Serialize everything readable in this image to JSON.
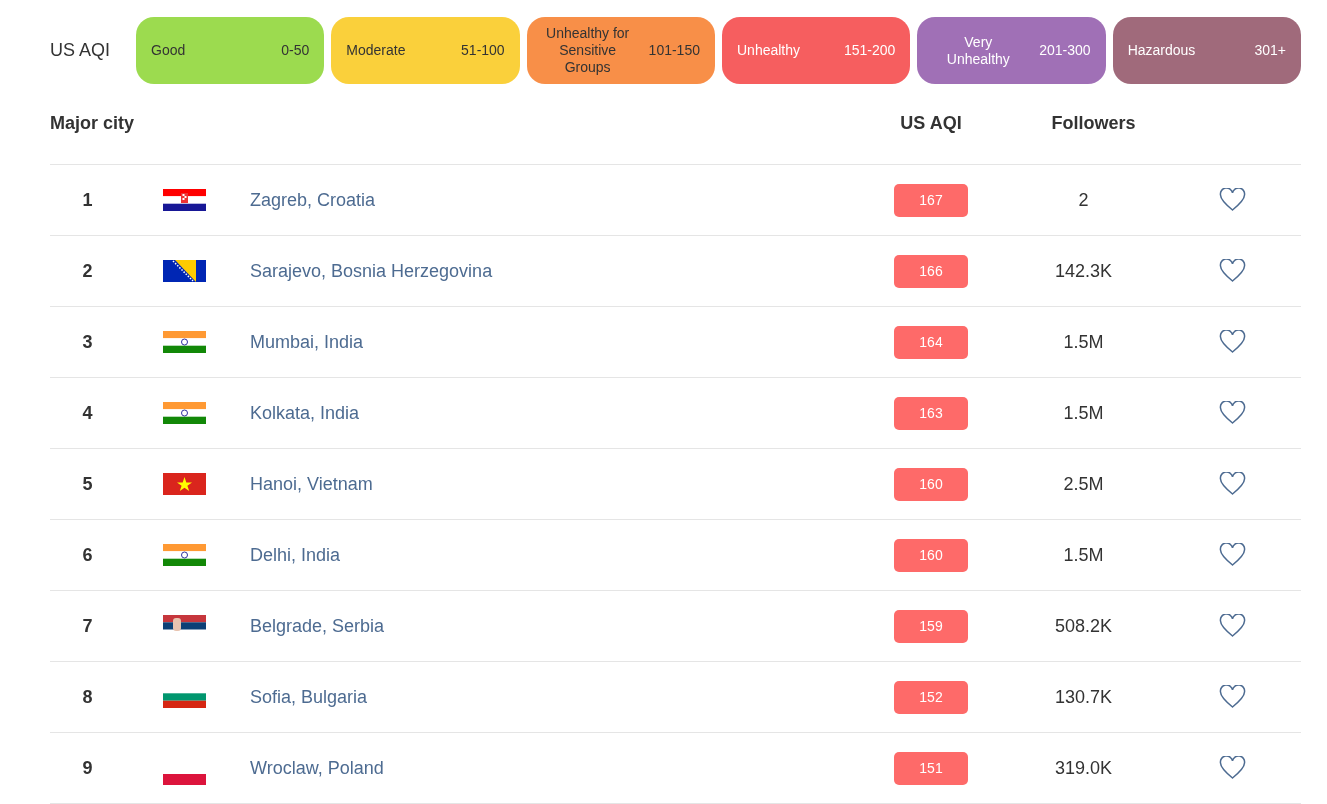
{
  "legend": {
    "label": "US AQI",
    "levels": [
      {
        "name": "Good",
        "range": "0-50",
        "color": "#9cdb4f"
      },
      {
        "name": "Moderate",
        "range": "51-100",
        "color": "#fad03b"
      },
      {
        "name": "Unhealthy for Sensitive Groups",
        "range": "101-150",
        "color": "#f88f48"
      },
      {
        "name": "Unhealthy",
        "range": "151-200",
        "color": "#f65e5f"
      },
      {
        "name": "Very Unhealthy",
        "range": "201-300",
        "color": "#a070b6"
      },
      {
        "name": "Hazardous",
        "range": "301+",
        "color": "#a06a7b"
      }
    ]
  },
  "table": {
    "columns": [
      "Major city",
      "US AQI",
      "Followers"
    ],
    "rows": [
      {
        "rank": "1",
        "kind": "hr",
        "city": "Zagreb, Croatia",
        "aqi": "167",
        "followers": "2"
      },
      {
        "rank": "2",
        "kind": "ba",
        "city": "Sarajevo, Bosnia Herzegovina",
        "aqi": "166",
        "followers": "142.3K"
      },
      {
        "rank": "3",
        "kind": "in",
        "city": "Mumbai, India",
        "aqi": "164",
        "followers": "1.5M"
      },
      {
        "rank": "4",
        "kind": "in",
        "city": "Kolkata, India",
        "aqi": "163",
        "followers": "1.5M"
      },
      {
        "rank": "5",
        "kind": "vn",
        "city": "Hanoi, Vietnam",
        "aqi": "160",
        "followers": "2.5M"
      },
      {
        "rank": "6",
        "kind": "in",
        "city": "Delhi, India",
        "aqi": "160",
        "followers": "1.5M"
      },
      {
        "rank": "7",
        "kind": "rs",
        "city": "Belgrade, Serbia",
        "aqi": "159",
        "followers": "508.2K"
      },
      {
        "rank": "8",
        "kind": "bg",
        "city": "Sofia, Bulgaria",
        "aqi": "152",
        "followers": "130.7K"
      },
      {
        "rank": "9",
        "kind": "pl",
        "city": "Wroclaw, Poland",
        "aqi": "151",
        "followers": "319.0K"
      }
    ]
  }
}
